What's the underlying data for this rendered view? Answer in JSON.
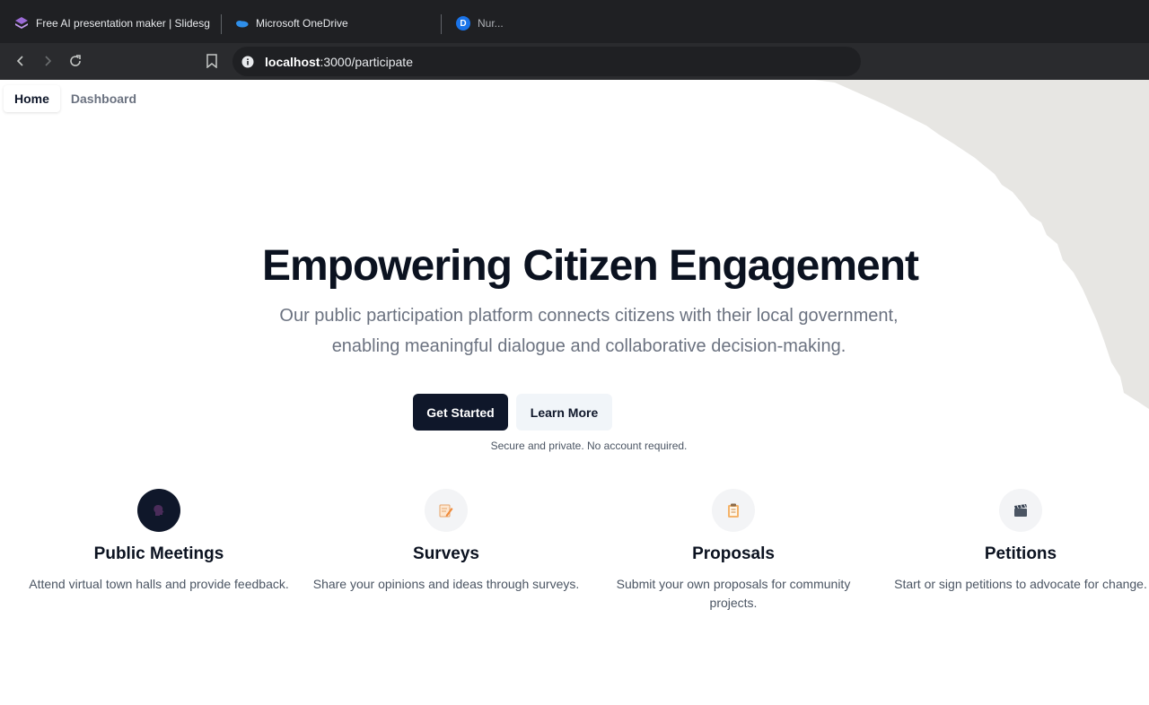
{
  "browser": {
    "tabs": [
      {
        "title": "Free AI presentation maker | Slidesg",
        "icon": "slidesgo-icon"
      },
      {
        "title": "Microsoft OneDrive",
        "icon": "onedrive-cloud-icon"
      },
      {
        "title": "Nur...",
        "icon": "d-badge-icon"
      }
    ],
    "url_host": "localhost",
    "url_path": ":3000/participate"
  },
  "nav": {
    "items": [
      {
        "label": "Home",
        "active": true
      },
      {
        "label": "Dashboard",
        "active": false
      }
    ]
  },
  "hero": {
    "title": "Empowering Citizen Engagement",
    "subtitle": "Our public participation platform connects citizens with their local government, enabling meaningful dialogue and collaborative decision-making.",
    "primary_button": "Get Started",
    "secondary_button": "Learn More",
    "note": "Secure and private. No account required."
  },
  "features": [
    {
      "title": "Public Meetings",
      "description": "Attend virtual town halls and provide feedback.",
      "icon": "speaking-head-icon"
    },
    {
      "title": "Surveys",
      "description": "Share your opinions and ideas through surveys.",
      "icon": "memo-pencil-icon"
    },
    {
      "title": "Proposals",
      "description": "Submit your own proposals for community projects.",
      "icon": "clipboard-icon"
    },
    {
      "title": "Petitions",
      "description": "Start or sign petitions to advocate for change.",
      "icon": "clapperboard-icon"
    }
  ],
  "colors": {
    "primary": "#0f172a",
    "muted_text": "#6b7280",
    "secondary_bg": "#f1f5f9"
  }
}
